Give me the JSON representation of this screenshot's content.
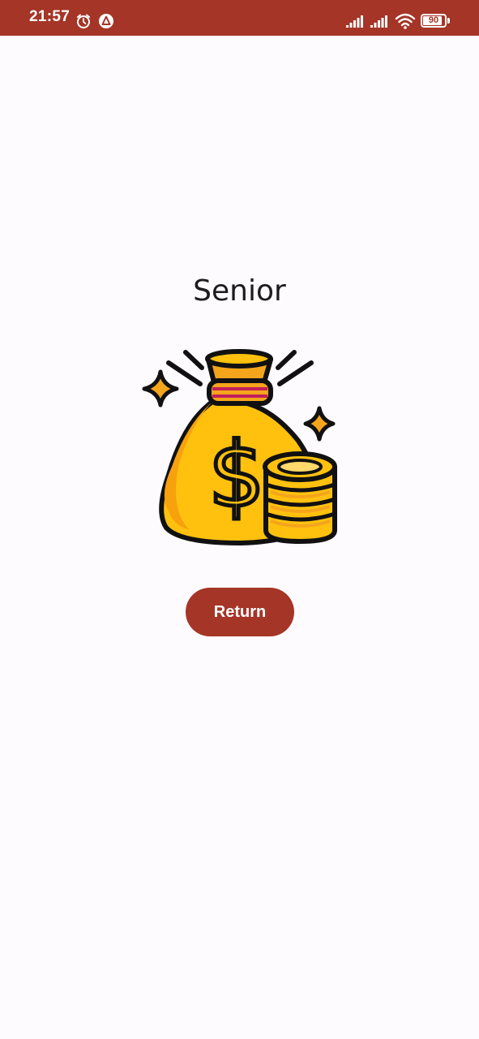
{
  "status_bar": {
    "time": "21:57",
    "battery_level": "90",
    "battery_fraction": 0.9,
    "icons": [
      "alarm-icon",
      "app-notification-icon",
      "signal-icon",
      "signal-icon",
      "wifi-icon",
      "battery-icon"
    ],
    "background_color": "#a53527"
  },
  "main": {
    "title": "Senior",
    "illustration": "money-bag-with-coins-icon",
    "return_label": "Return",
    "accent_color": "#a53527",
    "background_color": "#fefbfe"
  }
}
